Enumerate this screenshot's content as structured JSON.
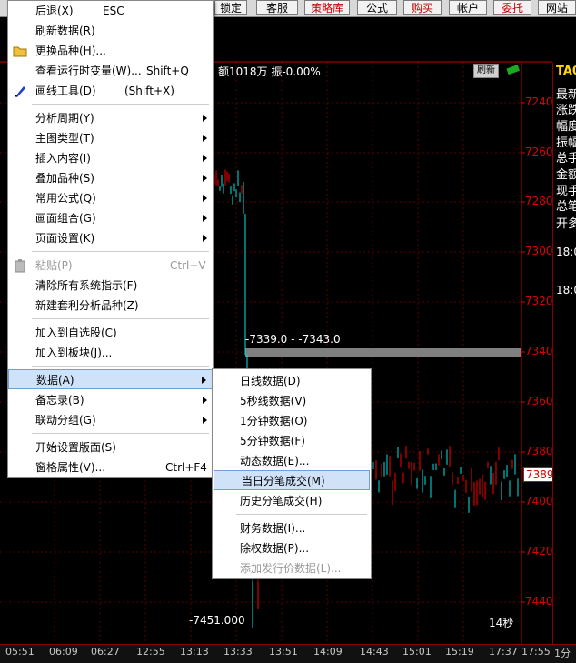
{
  "toolbar": {
    "buttons": [
      {
        "label": "锁定",
        "red": false
      },
      {
        "label": "客服",
        "red": false
      },
      {
        "label": "策略库",
        "red": true
      },
      {
        "label": "公式",
        "red": false
      },
      {
        "label": "购买",
        "red": true
      },
      {
        "label": "帐户",
        "red": false
      },
      {
        "label": "委托",
        "red": true
      },
      {
        "label": "网站",
        "red": false
      }
    ]
  },
  "chart": {
    "info_line": "额1018万 振-0.00%",
    "refresh_label": "刷新",
    "range_label": "-7339.0 - -7343.0",
    "low_label": "-7451.000",
    "interval_label": "14秒",
    "current_price": "7389",
    "accent_up": "#ff0000",
    "accent_down": "#00e5e5",
    "price_axis": [
      "7240",
      "7260",
      "7280",
      "7300",
      "7320",
      "7340",
      "7360",
      "7380",
      "7400",
      "7420",
      "7440"
    ],
    "time_axis": [
      "05:51",
      "06:09",
      "06:27",
      "12:55",
      "13:13",
      "13:33",
      "13:51",
      "14:09",
      "14:43",
      "15:01",
      "15:19",
      "17:37",
      "17:55",
      "1分"
    ]
  },
  "right_panel": {
    "code": "TA0",
    "labels": [
      "最新",
      "涨跌",
      "幅度",
      "振幅",
      "总手",
      "金额",
      "现手",
      "总笔",
      "开多"
    ],
    "times": [
      "18:0",
      "18:0"
    ]
  },
  "main_menu": {
    "items": [
      {
        "label": "后退(X)",
        "shortcut": "ESC"
      },
      {
        "label": "刷新数据(R)",
        "shortcut": ""
      },
      {
        "label": "更换品种(H)...",
        "shortcut": ""
      },
      {
        "label": "查看运行时变量(W)...",
        "shortcut": "Shift+Q"
      },
      {
        "label": "画线工具(D)",
        "shortcut": "(Shift+X)"
      },
      {
        "label": "分析周期(Y)",
        "submenu": true
      },
      {
        "label": "主图类型(T)",
        "submenu": true
      },
      {
        "label": "插入内容(I)",
        "submenu": true
      },
      {
        "label": "叠加品种(S)",
        "submenu": true
      },
      {
        "label": "常用公式(Q)",
        "submenu": true
      },
      {
        "label": "画面组合(G)",
        "submenu": true
      },
      {
        "label": "页面设置(K)",
        "submenu": true
      },
      {
        "label": "粘贴(P)",
        "shortcut": "Ctrl+V",
        "disabled": true
      },
      {
        "label": "清除所有系统指示(F)",
        "shortcut": ""
      },
      {
        "label": "新建套利分析品种(Z)",
        "shortcut": ""
      },
      {
        "label": "加入到自选股(C)",
        "shortcut": ""
      },
      {
        "label": "加入到板块(J)...",
        "shortcut": ""
      },
      {
        "label": "数据(A)",
        "submenu": true,
        "highlighted": true
      },
      {
        "label": "备忘录(B)",
        "submenu": true
      },
      {
        "label": "联动分组(G)",
        "submenu": true
      },
      {
        "label": "开始设置版面(S)",
        "shortcut": ""
      },
      {
        "label": "窗格属性(V)...",
        "shortcut": "Ctrl+F4"
      }
    ]
  },
  "sub_menu": {
    "items": [
      {
        "label": "日线数据(D)"
      },
      {
        "label": "5秒线数据(V)"
      },
      {
        "label": "1分钟数据(O)"
      },
      {
        "label": "5分钟数据(F)"
      },
      {
        "label": "动态数据(E)..."
      },
      {
        "label": "当日分笔成交(M)",
        "highlighted": true
      },
      {
        "label": "历史分笔成交(H)"
      },
      {
        "label": "财务数据(I)..."
      },
      {
        "label": "除权数据(P)..."
      },
      {
        "label": "添加发行价数据(L)...",
        "disabled": true
      }
    ]
  }
}
